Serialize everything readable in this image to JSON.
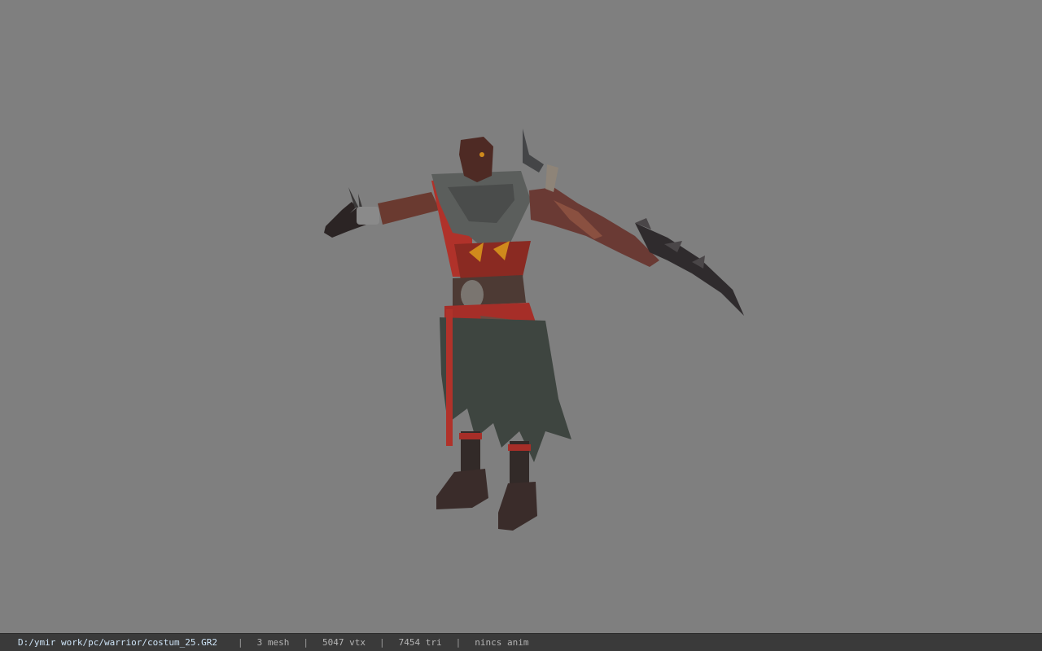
{
  "viewport": {
    "background": "#7f7f7f",
    "model": "warrior character in T-pose"
  },
  "statusbar": {
    "file_path": "D:/ymir work/pc/warrior/costum_25.GR2",
    "separator": "|",
    "mesh": "3 mesh",
    "vertices": "5047 vtx",
    "triangles": "7454 tri",
    "animation": "nincs anim"
  }
}
